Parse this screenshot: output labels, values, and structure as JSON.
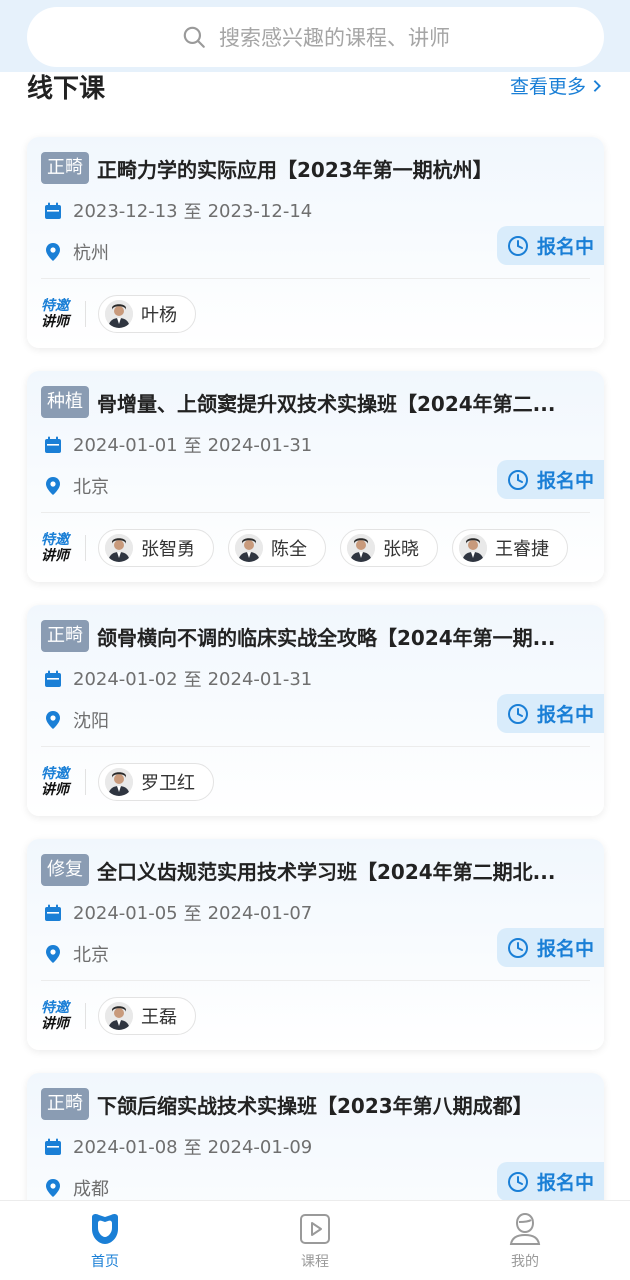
{
  "search": {
    "placeholder": "搜索感兴趣的课程、讲师"
  },
  "section": {
    "title": "线下课",
    "more_label": "查看更多"
  },
  "guest_badge": {
    "line1": "特邀",
    "line2": "讲师"
  },
  "courses": [
    {
      "tag": "正畸",
      "title": "正畸力学的实际应用【2023年第一期杭州】",
      "date_start": "2023-12-13",
      "date_sep": "至",
      "date_end": "2023-12-14",
      "location": "杭州",
      "status": "报名中",
      "lecturers": [
        "叶杨"
      ]
    },
    {
      "tag": "种植",
      "title": "骨增量、上颌窦提升双技术实操班【2024年第二...",
      "date_start": "2024-01-01",
      "date_sep": "至",
      "date_end": "2024-01-31",
      "location": "北京",
      "status": "报名中",
      "lecturers": [
        "张智勇",
        "陈全",
        "张晓",
        "王睿捷"
      ]
    },
    {
      "tag": "正畸",
      "title": "颌骨横向不调的临床实战全攻略【2024年第一期...",
      "date_start": "2024-01-02",
      "date_sep": "至",
      "date_end": "2024-01-31",
      "location": "沈阳",
      "status": "报名中",
      "lecturers": [
        "罗卫红"
      ]
    },
    {
      "tag": "修复",
      "title": "全口义齿规范实用技术学习班【2024年第二期北...",
      "date_start": "2024-01-05",
      "date_sep": "至",
      "date_end": "2024-01-07",
      "location": "北京",
      "status": "报名中",
      "lecturers": [
        "王磊"
      ]
    },
    {
      "tag": "正畸",
      "title": "下颌后缩实战技术实操班【2023年第八期成都】",
      "date_start": "2024-01-08",
      "date_sep": "至",
      "date_end": "2024-01-09",
      "location": "成都",
      "status": "报名中",
      "lecturers": []
    }
  ],
  "tabbar": [
    {
      "label": "首页",
      "icon": "tooth-icon",
      "active": true
    },
    {
      "label": "课程",
      "icon": "play-icon",
      "active": false
    },
    {
      "label": "我的",
      "icon": "user-icon",
      "active": false
    }
  ],
  "colors": {
    "accent": "#1a7fd6",
    "tag_bg": "#8a9cb3",
    "status_bg": "#d9ecfb"
  }
}
